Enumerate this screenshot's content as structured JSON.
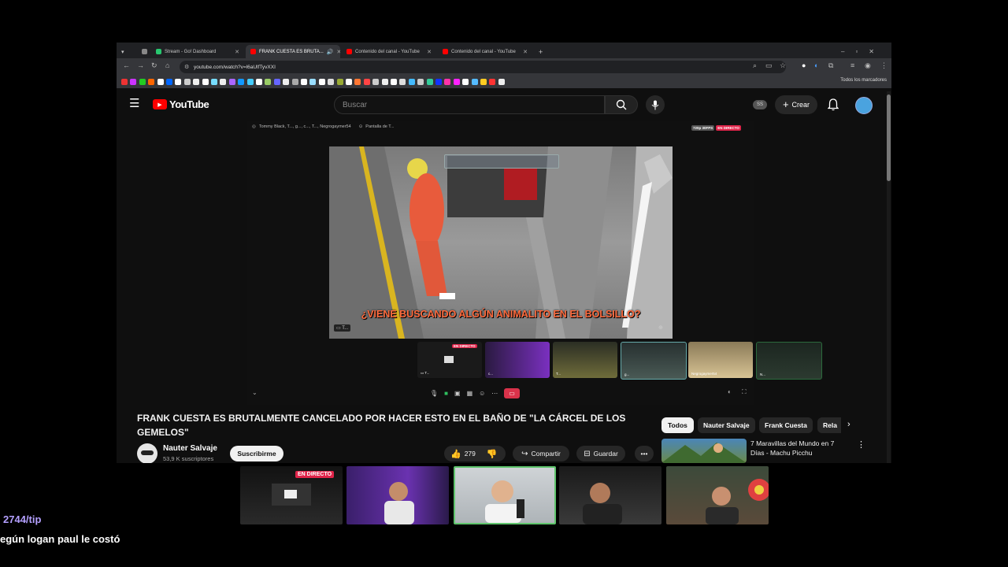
{
  "browser": {
    "tabs": [
      {
        "label": "Stream - Go! Dashboard",
        "color": "#28c76f"
      },
      {
        "label": "FRANK CUESTA ES BRUTA...",
        "color": "#ff0000"
      },
      {
        "label": "Contenido del canal - YouTube",
        "color": "#ff0000"
      },
      {
        "label": "Contenido del canal - YouTube",
        "color": "#ff0000"
      }
    ],
    "url": "youtube.com/watch?v=l6aUlfTyvXXI",
    "bookmarks_all": "Todos los marcadores"
  },
  "youtube": {
    "logo_text": "YouTube",
    "search_placeholder": "Buscar",
    "create_label": "Crear",
    "avatar_initials": "SS"
  },
  "video": {
    "top_left_participants": "Tommy Black, T..., g..., c..., T..., Negrogaymer54",
    "top_screen_label": "Pantalla de T...",
    "quality_badge": "720p 30FPS",
    "live_badge": "EN DIRECTO",
    "subtitle": "¿VIENE BUSCANDO ALGÚN ANIMALITO EN EL BOLSILLO?",
    "thumb_live_badge": "EN DIRECTO",
    "thumb_label": "Negrogaymer54"
  },
  "info": {
    "title": "FRANK CUESTA ES BRUTALMENTE CANCELADO POR HACER ESTO EN EL BAÑO DE \"LA CÁRCEL DE LOS GEMELOS\"",
    "channel_name": "Nauter Salvaje",
    "subscribers": "53,9 K suscriptores",
    "subscribe_label": "Suscribirme",
    "likes": "279",
    "share_label": "Compartir",
    "save_label": "Guardar"
  },
  "chips": [
    "Todos",
    "Nauter Salvaje",
    "Frank Cuesta",
    "Rela"
  ],
  "recommendation": {
    "title": "7 Maravillas del Mundo en 7 Días - Machu Picchu"
  },
  "stream_overlay": {
    "cam_live_badge": "EN DIRECTO",
    "tip_text": "2744/tip",
    "donation_text": "egún logan paul le costó"
  }
}
